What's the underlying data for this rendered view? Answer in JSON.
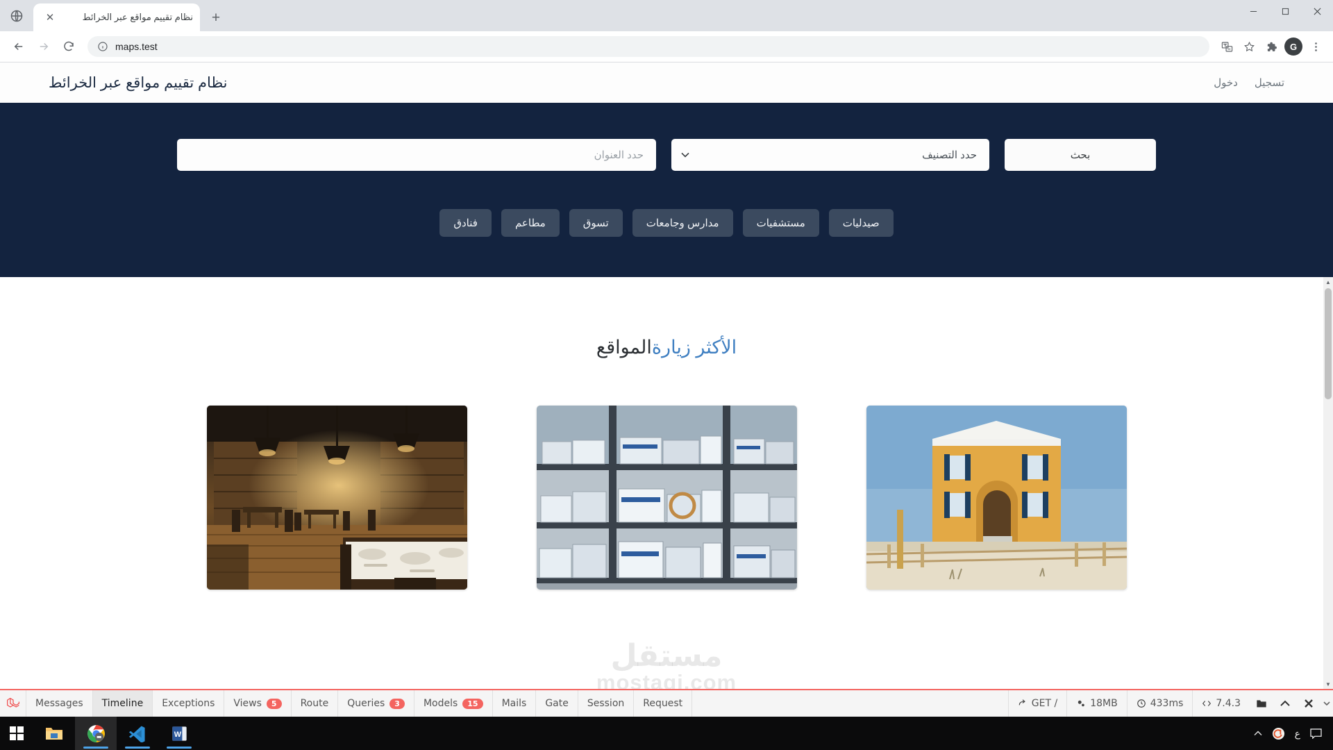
{
  "browser": {
    "tab": {
      "title": "نظام تقييم مواقع عبر الخرائط",
      "close_label": "✕"
    },
    "new_tab_label": "+",
    "window_controls": {
      "minimize": "—",
      "maximize": "▫",
      "close": "✕"
    },
    "omnibox": {
      "url": "maps.test",
      "security_icon": "info-icon"
    },
    "toolbar_icons": [
      "translate-icon",
      "bookmark-star-icon",
      "extensions-puzzle-icon",
      "profile-avatar",
      "chrome-menu-icon"
    ],
    "profile_initial": "G"
  },
  "site": {
    "title": "نظام تقييم مواقع عبر الخرائط",
    "nav_links": [
      {
        "label": "تسجيل",
        "name": "nav-link-register"
      },
      {
        "label": "دخول",
        "name": "nav-link-login"
      }
    ]
  },
  "hero": {
    "address_placeholder": "حدد العنوان",
    "address_value": "",
    "category_placeholder": "حدد التصنيف",
    "category_options": [
      "حدد التصنيف",
      "فنادق",
      "مطاعم",
      "تسوق",
      "مدارس وجامعات",
      "مستشفيات",
      "صيدليات"
    ],
    "search_button": "بحث",
    "chips": [
      {
        "label": "صيدليات",
        "name": "chip-pharmacies"
      },
      {
        "label": "مستشفيات",
        "name": "chip-hospitals"
      },
      {
        "label": "مدارس وجامعات",
        "name": "chip-schools-universities"
      },
      {
        "label": "تسوق",
        "name": "chip-shopping"
      },
      {
        "label": "مطاعم",
        "name": "chip-restaurants"
      },
      {
        "label": "فنادق",
        "name": "chip-hotels"
      }
    ],
    "background_color": "#13233f",
    "chip_color": "#3b4a5f"
  },
  "section": {
    "title_plain": "المواقع ",
    "title_accent": "الأكثر زيارة",
    "accent_color": "#3f7fc1",
    "cards": [
      {
        "name": "card-restaurant",
        "alt": "مطعم"
      },
      {
        "name": "card-warehouse",
        "alt": "مستودع"
      },
      {
        "name": "card-building",
        "alt": "مبنى"
      }
    ]
  },
  "watermark": {
    "line1": "مستقل",
    "line2": "mostaqi.com"
  },
  "debugbar": {
    "logo": "laravel-logo",
    "tabs": [
      {
        "label": "Messages",
        "badge": null,
        "active": false,
        "name": "debug-tab-messages"
      },
      {
        "label": "Timeline",
        "badge": null,
        "active": true,
        "name": "debug-tab-timeline"
      },
      {
        "label": "Exceptions",
        "badge": null,
        "active": false,
        "name": "debug-tab-exceptions"
      },
      {
        "label": "Views",
        "badge": "5",
        "active": false,
        "name": "debug-tab-views"
      },
      {
        "label": "Route",
        "badge": null,
        "active": false,
        "name": "debug-tab-route"
      },
      {
        "label": "Queries",
        "badge": "3",
        "active": false,
        "name": "debug-tab-queries"
      },
      {
        "label": "Models",
        "badge": "15",
        "active": false,
        "name": "debug-tab-models"
      },
      {
        "label": "Mails",
        "badge": null,
        "active": false,
        "name": "debug-tab-mails"
      },
      {
        "label": "Gate",
        "badge": null,
        "active": false,
        "name": "debug-tab-gate"
      },
      {
        "label": "Session",
        "badge": null,
        "active": false,
        "name": "debug-tab-session"
      },
      {
        "label": "Request",
        "badge": null,
        "active": false,
        "name": "debug-tab-request"
      }
    ],
    "stats": [
      {
        "icon": "arrow-right-icon",
        "label": "GET /",
        "name": "debug-stat-request-method"
      },
      {
        "icon": "gears-icon",
        "label": "18MB",
        "name": "debug-stat-memory"
      },
      {
        "icon": "clock-icon",
        "label": "433ms",
        "name": "debug-stat-time"
      },
      {
        "icon": "code-icon",
        "label": "7.4.3",
        "name": "debug-stat-php-version"
      }
    ],
    "controls": [
      "folder-icon",
      "collapse-up-icon",
      "close-icon"
    ],
    "accent_color": "#f4645f"
  },
  "taskbar": {
    "start": "windows-start-icon",
    "apps": [
      {
        "name": "taskbar-file-explorer",
        "icon": "folder-icon"
      },
      {
        "name": "taskbar-chrome",
        "icon": "chrome-icon"
      },
      {
        "name": "taskbar-vscode",
        "icon": "vscode-icon"
      },
      {
        "name": "taskbar-word",
        "icon": "word-icon"
      }
    ],
    "tray": [
      {
        "name": "tray-show-hidden-icons",
        "icon": "chevron-up-icon"
      },
      {
        "name": "tray-app-icon",
        "icon": "orange-circle-icon"
      },
      {
        "name": "tray-language-indicator",
        "label": "ع"
      },
      {
        "name": "tray-action-center",
        "icon": "notification-icon"
      }
    ]
  }
}
